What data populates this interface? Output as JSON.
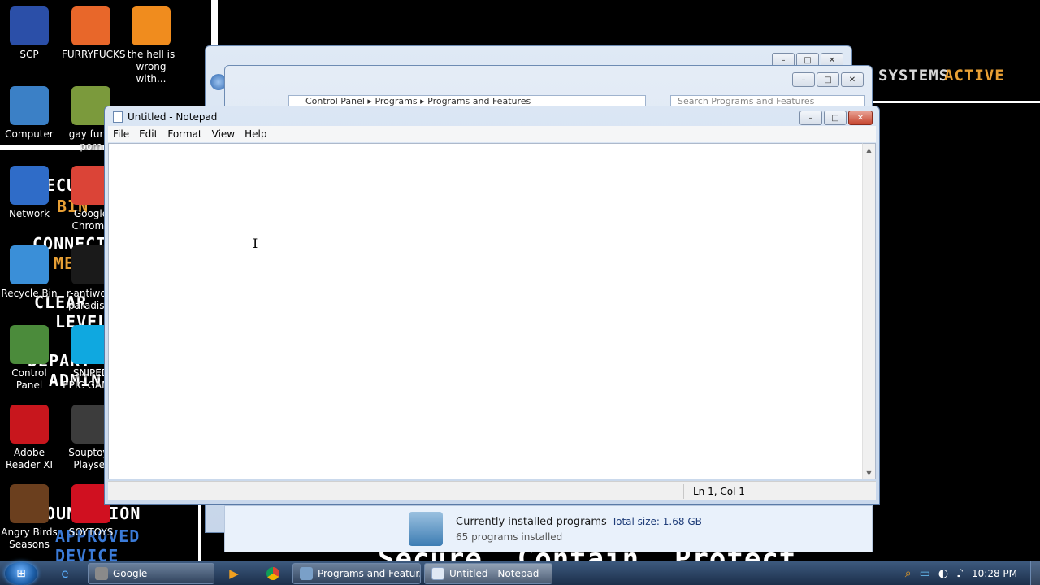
{
  "desktop": {
    "icons": [
      {
        "label": "SCP",
        "icon": "scp-icon",
        "color": "#2b4fa8"
      },
      {
        "label": "FURRYFUCKS",
        "icon": "firefox-icon",
        "color": "#e8672a"
      },
      {
        "label": "the hell is wrong with...",
        "icon": "uc-browser-icon",
        "color": "#f08c1e"
      },
      {
        "label": "Computer",
        "icon": "computer-icon",
        "color": "#3b80c6"
      },
      {
        "label": "gay furry porn",
        "icon": "game-icon",
        "color": "#7b9a3c"
      },
      {
        "label": "Network",
        "icon": "network-icon",
        "color": "#2f6cc8"
      },
      {
        "label": "Google Chrome",
        "icon": "chrome-icon",
        "color": "#db4437"
      },
      {
        "label": "Recycle Bin",
        "icon": "recycle-bin-icon",
        "color": "#3a8fd8"
      },
      {
        "label": "r-antiwo... paradis...",
        "icon": "reddit-icon",
        "color": "#1a1a1a"
      },
      {
        "label": "Control Panel",
        "icon": "control-panel-icon",
        "color": "#4b8b3b"
      },
      {
        "label": "SNIPED EPIC GAM...",
        "icon": "skype-icon",
        "color": "#0fa8e0"
      },
      {
        "label": "Adobe Reader XI",
        "icon": "adobe-reader-icon",
        "color": "#c8161d"
      },
      {
        "label": "Souptoys Playset",
        "icon": "souptoys-icon",
        "color": "#3c3c3c"
      },
      {
        "label": "Angry Birds Seasons",
        "icon": "angry-birds-icon",
        "color": "#6b3f1e"
      },
      {
        "label": "SOYTOYS",
        "icon": "soytoys-icon",
        "color": "#d01020"
      }
    ],
    "bg_texts": {
      "systems": "SYSTEMS",
      "active": "ACTIVE",
      "ecu": "ECU",
      "bin": "BIN",
      "connect": "CONNECT",
      "me": "ME",
      "clear": "CLEAR",
      "level": "LEVEL",
      "depart": "DEPART",
      "admin": "ADMIN",
      "foundation": "OUNDATION",
      "approved": "APPROVED",
      "device": "DEVICE",
      "secure": "Secure. Contain. Protect."
    }
  },
  "programs_window": {
    "breadcrumb": [
      "Control Panel",
      "Programs",
      "Programs and Features"
    ],
    "search_placeholder": "Search Programs and Features",
    "installed_label": "Currently installed programs",
    "total_size": "Total size: 1.68 GB",
    "count": "65 programs installed"
  },
  "notepad": {
    "title": "Untitled - Notepad",
    "menu": [
      "File",
      "Edit",
      "Format",
      "View",
      "Help"
    ],
    "content": "",
    "status": "Ln 1, Col 1"
  },
  "window_buttons": {
    "minimize": "–",
    "maximize": "□",
    "close": "✕"
  },
  "taskbar": {
    "items": [
      {
        "label": "Google",
        "icon": "google-app-icon"
      },
      {
        "label": "Programs and Featur...",
        "icon": "programs-features-icon"
      },
      {
        "label": "Untitled - Notepad",
        "icon": "notepad-icon"
      }
    ],
    "clock": "10:28 PM"
  }
}
